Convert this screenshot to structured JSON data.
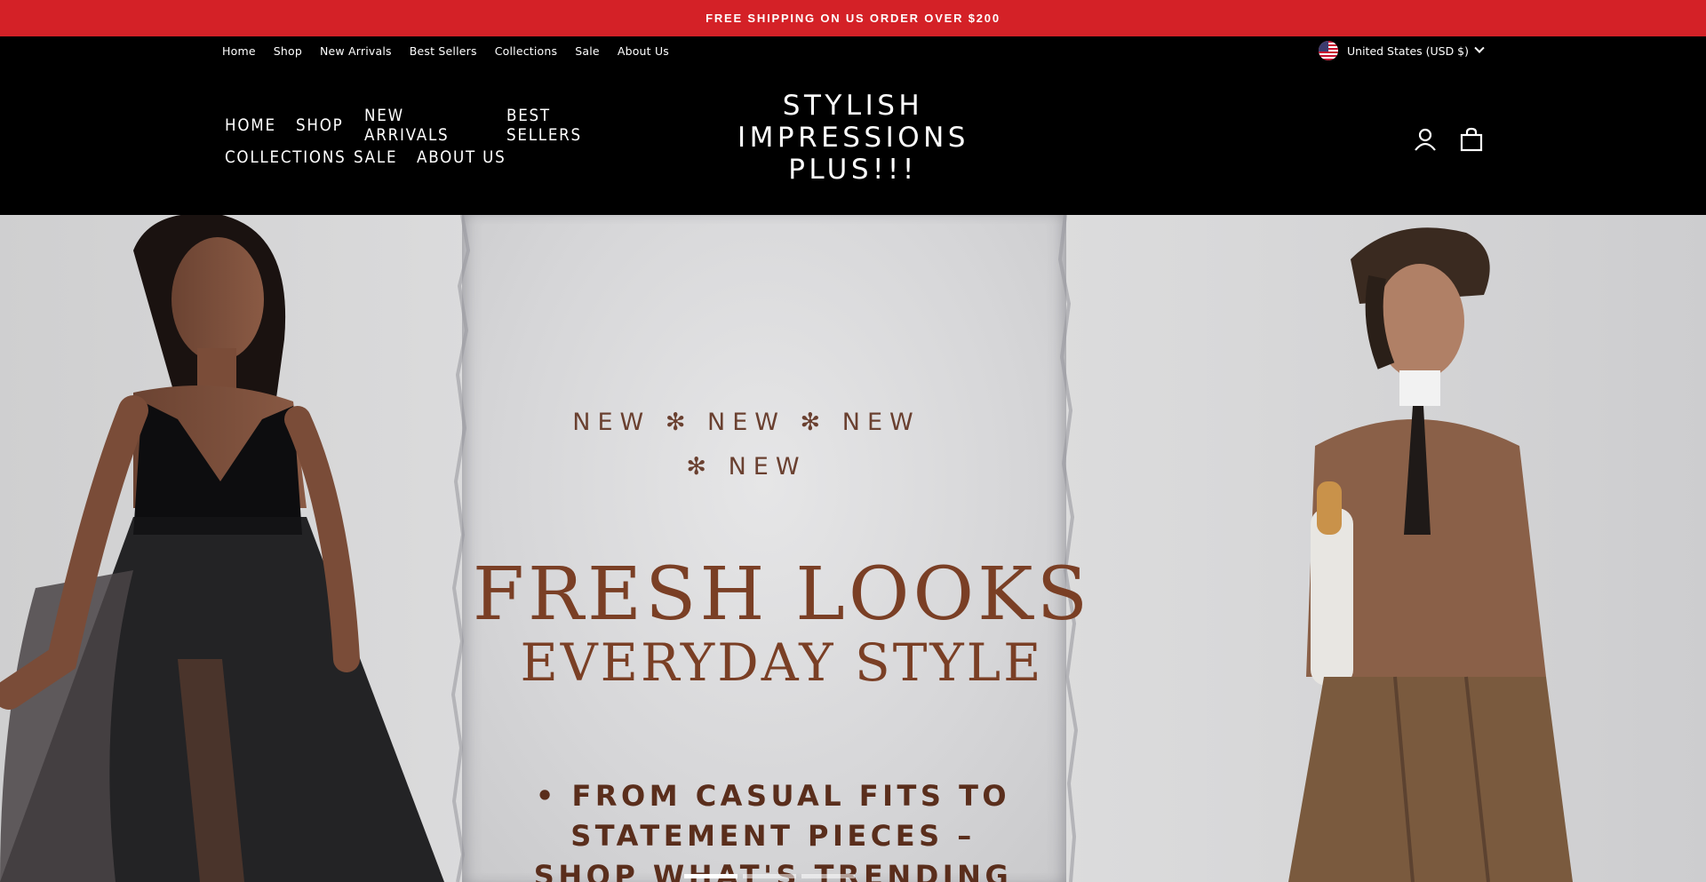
{
  "announcement": "FREE SHIPPING ON US ORDER OVER $200",
  "utility_nav": [
    "Home",
    "Shop",
    "New Arrivals",
    "Best Sellers",
    "Collections",
    "Sale",
    "About Us"
  ],
  "currency": {
    "label": "United States (USD $)",
    "flag": "us-flag-icon"
  },
  "main_nav": {
    "row1": [
      "HOME",
      "SHOP",
      "NEW ARRIVALS",
      "BEST SELLERS"
    ],
    "row2": [
      "COLLECTIONS",
      "SALE",
      "ABOUT US"
    ]
  },
  "logo": {
    "line1": "STYLISH",
    "line2": "IMPRESSIONS",
    "line3": "PLUS!!!"
  },
  "header_icons": [
    "account-icon",
    "cart-icon"
  ],
  "hero": {
    "new_line1": "NEW ✻ NEW ✻ NEW",
    "new_line2": "✻ NEW",
    "headline": "FRESH LOOKS",
    "subheadline": "EVERYDAY STYLE",
    "bullet_line1": "• FROM CASUAL FITS TO",
    "bullet_line2": "STATEMENT PIECES –",
    "bullet_line3": "SHOP WHAT'S TRENDING",
    "slides": 3,
    "active_slide": 1
  },
  "colors": {
    "announcement_bg": "#d42127",
    "header_bg": "#000000",
    "hero_text": "#7a3f25"
  }
}
